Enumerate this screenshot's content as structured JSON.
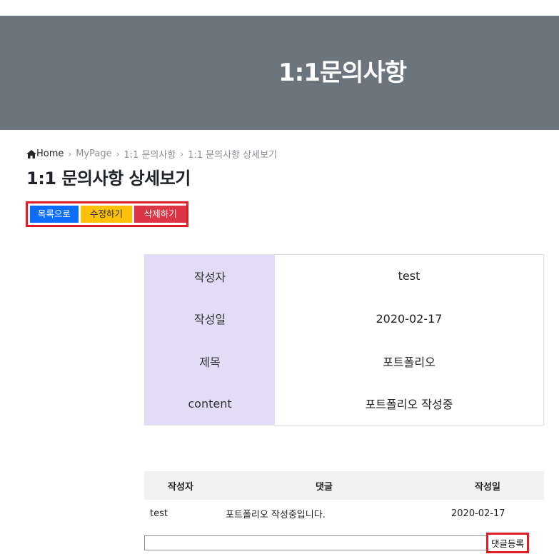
{
  "hero": {
    "title": "1:1문의사항"
  },
  "breadcrumb": {
    "items": [
      "Home",
      "MyPage",
      "1:1 문의사항",
      "1:1 문의사항 상세보기"
    ],
    "home_icon": "home-icon",
    "separator_icon": "chevron-right-icon"
  },
  "page_title": "1:1 문의사항 상세보기",
  "actions": {
    "list_label": "목록으로",
    "edit_label": "수정하기",
    "delete_label": "삭제하기"
  },
  "detail": {
    "rows": [
      {
        "label": "작성자",
        "value": "test"
      },
      {
        "label": "작성일",
        "value": "2020-02-17"
      },
      {
        "label": "제목",
        "value": "포트폴리오"
      },
      {
        "label": "content",
        "value": "포트폴리오 작성중"
      }
    ]
  },
  "comments": {
    "headers": [
      "작성자",
      "댓글",
      "작성일"
    ],
    "rows": [
      {
        "author": "test",
        "text": "포트폴리오 작성중입니다.",
        "date": "2020-02-17"
      }
    ],
    "input_value": "",
    "submit_label": "댓글등록"
  },
  "colors": {
    "hero_bg": "#6c757d",
    "primary": "#0d6efd",
    "warning": "#ffc107",
    "danger": "#dc3545",
    "label_bg": "#e2dcf7",
    "highlight": "#e41c23"
  }
}
